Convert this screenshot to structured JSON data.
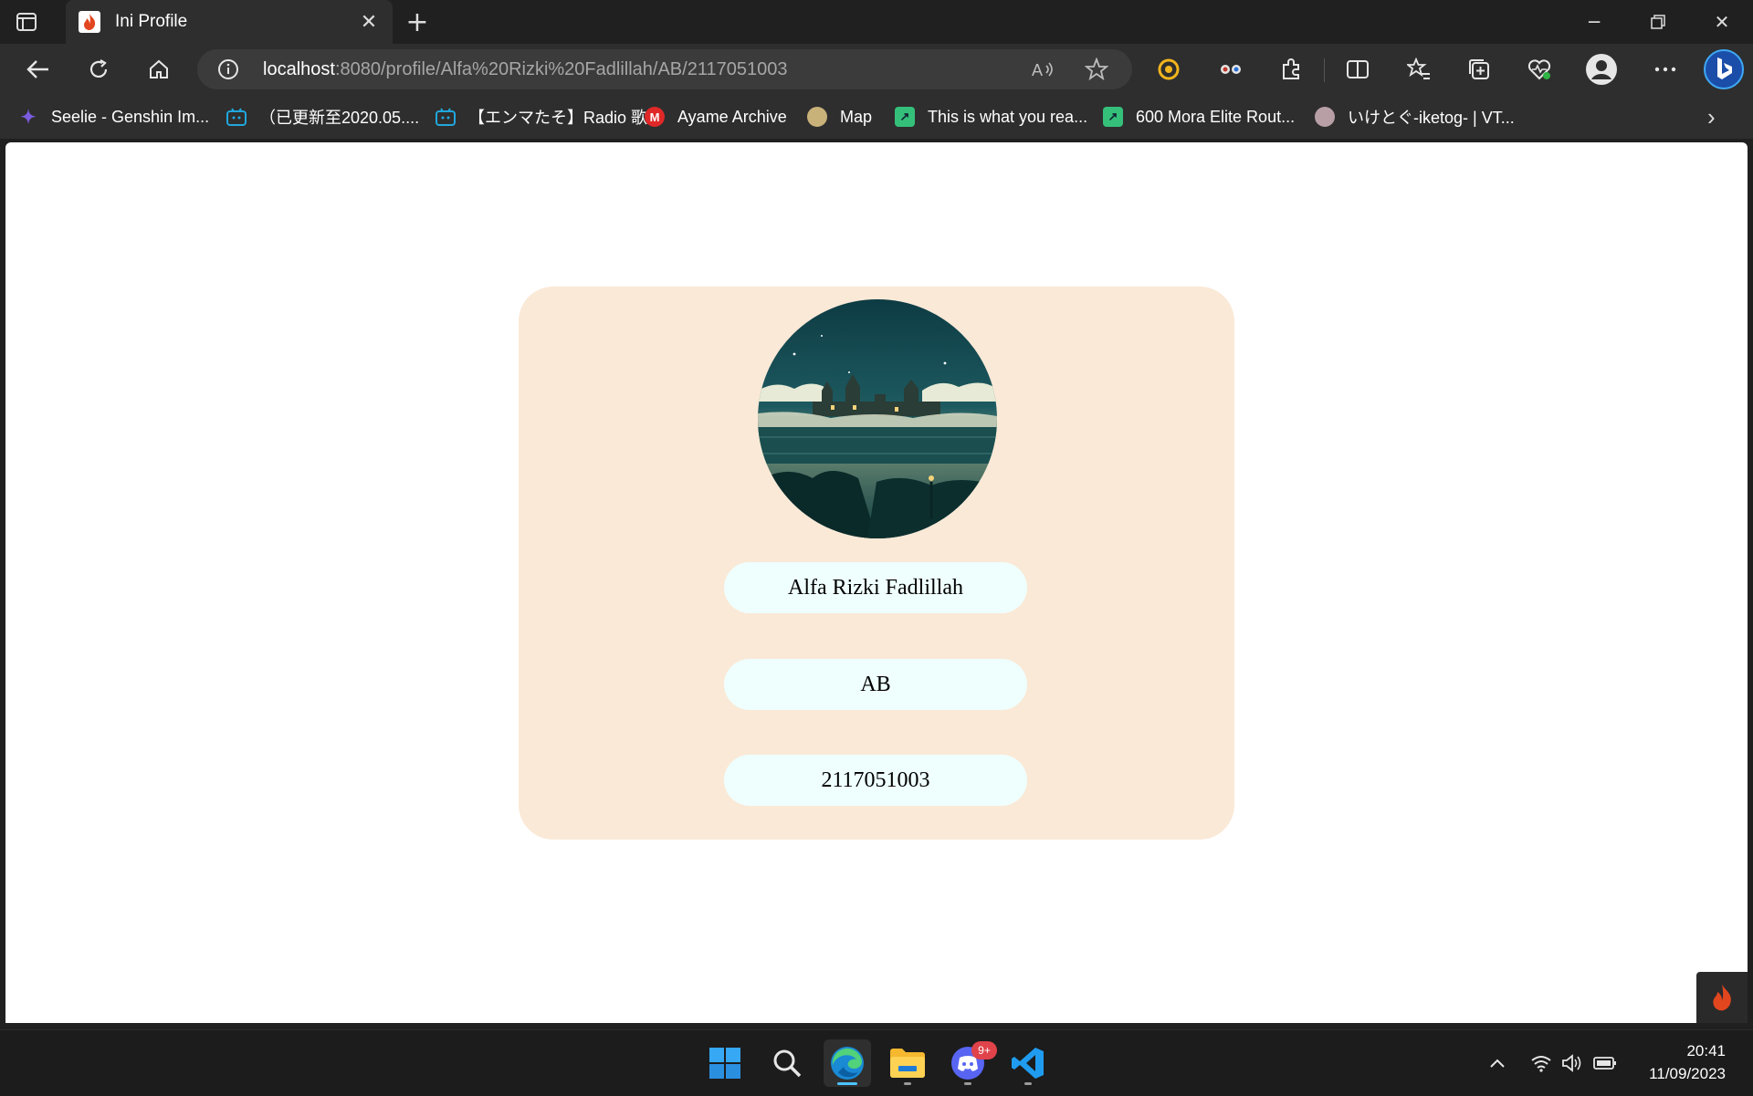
{
  "browser": {
    "tab": {
      "title": "Ini Profile"
    },
    "address": {
      "host": "localhost",
      "path": ":8080/profile/Alfa%20Rizki%20Fadlillah/AB/2117051003"
    },
    "bookmarks": [
      {
        "label": "Seelie - Genshin Im...",
        "icon": "butterfly-icon",
        "color": "#7b5ce0"
      },
      {
        "label": "（已更新至2020.05....",
        "icon": "bilibili-icon",
        "color": "#20a7dd"
      },
      {
        "label": "【エンマたそ】Radio 歌...",
        "icon": "bilibili-icon",
        "color": "#20a7dd"
      },
      {
        "label": "Ayame Archive",
        "icon": "m-logo-icon",
        "color": "#e02828"
      },
      {
        "label": "Map",
        "icon": "map-icon",
        "color": "#c9b27a"
      },
      {
        "label": "This is what you rea...",
        "icon": "route-icon",
        "color": "#35c07a"
      },
      {
        "label": "600 Mora Elite Rout...",
        "icon": "route-icon",
        "color": "#35c07a"
      },
      {
        "label": "いけとぐ-iketog- | VT...",
        "icon": "avatar-icon",
        "color": "#b89fa6"
      }
    ]
  },
  "profile": {
    "name": "Alfa Rizki Fadlillah",
    "class": "AB",
    "npm": "2117051003"
  },
  "taskbar": {
    "discord_badge": "9+",
    "time": "20:41",
    "date": "11/09/2023"
  },
  "colors": {
    "card": "#fae9d7",
    "field": "#effffe",
    "accent": "#4cc2ff"
  }
}
